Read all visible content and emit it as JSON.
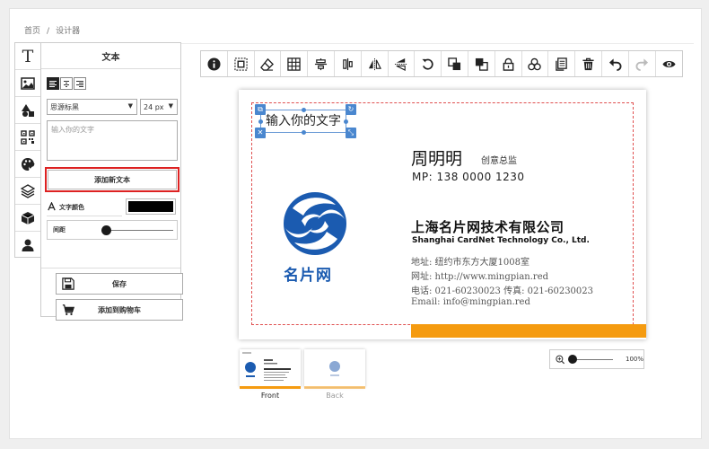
{
  "breadcrumb": {
    "home": "首页",
    "separator": "/",
    "current": "设计器"
  },
  "left_tabs": [
    "text-icon",
    "image-icon",
    "shapes-icon",
    "qrcode-icon",
    "palette-icon",
    "layers-icon",
    "cube-icon",
    "user-icon"
  ],
  "panel": {
    "title": "文本",
    "font_select": "思源标黑",
    "size_select": "24 px",
    "textarea_placeholder": "输入你的文字",
    "add_button": "添加新文本",
    "color_label": "文字颜色",
    "color_value": "#000000",
    "spacing_label": "间距",
    "spacing_value": 0.05,
    "save_button": "保存",
    "cart_button": "添加到购物车"
  },
  "toolbar": [
    "info-icon",
    "select-area-icon",
    "eraser-icon",
    "grid-icon",
    "align-center-h-icon",
    "align-center-v-icon",
    "flip-h-icon",
    "flip-v-icon",
    "rotate-icon",
    "bring-forward-icon",
    "send-backward-icon",
    "lock-icon",
    "group-icon",
    "copy-icon",
    "delete-icon",
    "undo-icon",
    "redo-icon",
    "preview-icon"
  ],
  "card": {
    "selected_text": "输入你的文字",
    "name": "周明明",
    "title": "创意总监",
    "mp": "MP: 138 0000 1230",
    "company_cn": "上海名片网技术有限公司",
    "company_en": "Shanghai CardNet Technology Co., Ltd.",
    "address": "地址: 纽约市东方大厦1008室",
    "website": "网址: http://www.mingpian.red",
    "phone": "电话: 021-60230023   传真: 021-60230023",
    "email": "Email: info@mingpian.red",
    "logo_text": "名片网",
    "accent_color": "#f59b10",
    "logo_color": "#1b5bb0"
  },
  "thumbnails": {
    "front": "Front",
    "back": "Back"
  },
  "zoom": {
    "value": "100%"
  }
}
